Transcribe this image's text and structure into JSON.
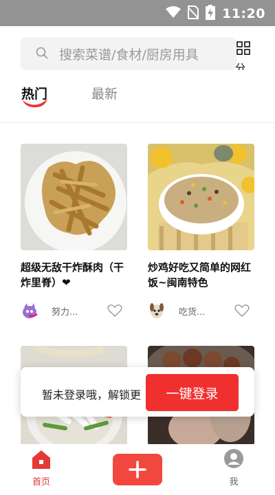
{
  "status_bar": {
    "time": "11:20",
    "icons": [
      "wifi-icon",
      "no-sim-icon",
      "battery-charging-icon"
    ]
  },
  "search": {
    "placeholder": "搜索菜谱/食材/厨房用具"
  },
  "category_button": {
    "label": "分",
    "icon": "grid-icon"
  },
  "tabs": [
    {
      "label": "热门",
      "active": true
    },
    {
      "label": "最新",
      "active": false
    }
  ],
  "recipes": [
    {
      "title": "超级无敌干炸酥肉（干炸里脊）❤",
      "author": "努力...",
      "image": "fried-pork-photo"
    },
    {
      "title": "炒鸡好吃又简单的网红饭~闽南特色",
      "author": "吃货...",
      "image": "fried-rice-photo"
    },
    {
      "title": "",
      "author": "",
      "image": "salad-photo"
    },
    {
      "title": "",
      "author": "",
      "image": "meatballs-photo"
    }
  ],
  "login_prompt": {
    "message": "暂未登录哦，解锁更",
    "button_label": "一键登录"
  },
  "bottom_nav": {
    "home_label": "首页",
    "me_label": "我"
  },
  "colors": {
    "accent": "#f0302e",
    "status_bar": "#939393"
  }
}
